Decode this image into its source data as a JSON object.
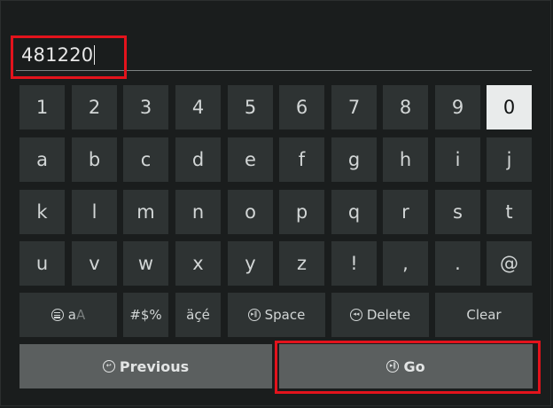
{
  "input": {
    "value": "481220"
  },
  "rows": [
    [
      "1",
      "2",
      "3",
      "4",
      "5",
      "6",
      "7",
      "8",
      "9",
      "0"
    ],
    [
      "a",
      "b",
      "c",
      "d",
      "e",
      "f",
      "g",
      "h",
      "i",
      "j"
    ],
    [
      "k",
      "l",
      "m",
      "n",
      "o",
      "p",
      "q",
      "r",
      "s",
      "t"
    ],
    [
      "u",
      "v",
      "w",
      "x",
      "y",
      "z",
      "!",
      ",",
      ".",
      "@"
    ]
  ],
  "selected_key": "0",
  "function_row": {
    "case_toggle": {
      "icon": "menu-icon",
      "label": "a",
      "label_dim": "A"
    },
    "symbols": "#$%",
    "accents": "äçé",
    "space": {
      "icon": "play-pause-icon",
      "label": "Space"
    },
    "delete": {
      "icon": "rewind-icon",
      "label": "Delete"
    },
    "clear": "Clear"
  },
  "bottom_row": {
    "previous": {
      "icon": "back-icon",
      "label": "Previous"
    },
    "go": {
      "icon": "play-pause-icon",
      "label": "Go"
    }
  },
  "colors": {
    "highlight": "#e3131c",
    "key_bg": "#2e3333",
    "selected_key_bg": "#e9ebeb",
    "bar_bg": "#5b5f5f"
  }
}
